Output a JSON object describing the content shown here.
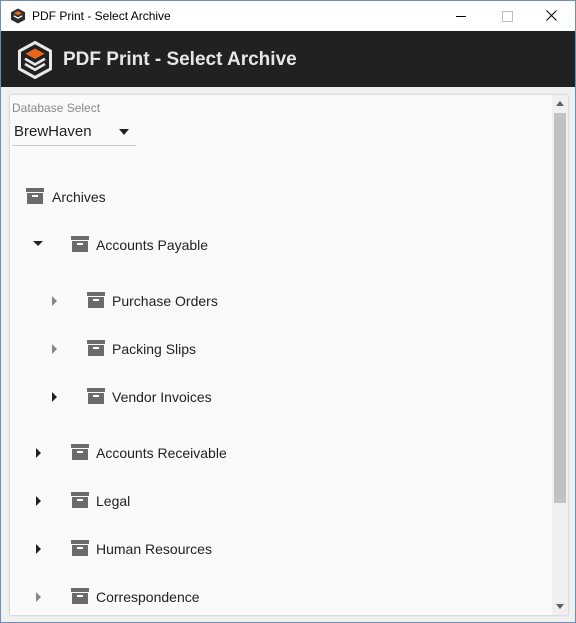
{
  "window": {
    "title": "PDF Print - Select Archive",
    "controls": [
      "minimize",
      "maximize",
      "close"
    ]
  },
  "header": {
    "title": "PDF Print - Select Archive",
    "logo_icon": "archive-box-logo-icon",
    "background": "#212121",
    "accent": "#e8661c"
  },
  "database_select": {
    "label": "Database Select",
    "value": "BrewHaven"
  },
  "tree": {
    "root": {
      "label": "Archives",
      "icon": "archive-icon"
    },
    "nodes": [
      {
        "label": "Accounts Payable",
        "level": 1,
        "expanded": true
      },
      {
        "label": "Purchase Orders",
        "level": 2,
        "expanded": false
      },
      {
        "label": "Packing Slips",
        "level": 2,
        "expanded": false
      },
      {
        "label": "Vendor Invoices",
        "level": 2,
        "expanded": false
      },
      {
        "label": "Accounts Receivable",
        "level": 1,
        "expanded": false
      },
      {
        "label": "Legal",
        "level": 1,
        "expanded": false
      },
      {
        "label": "Human Resources",
        "level": 1,
        "expanded": false
      },
      {
        "label": "Correspondence",
        "level": 1,
        "expanded": false
      }
    ]
  }
}
